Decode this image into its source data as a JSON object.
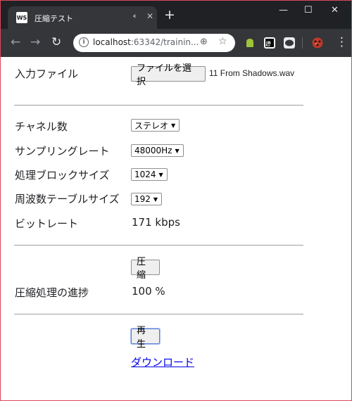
{
  "browser": {
    "tab": {
      "favicon_text": "WS",
      "title": "圧縮テスト",
      "audio_icon": "speaker-icon",
      "close_label": "✕"
    },
    "new_tab_label": "+",
    "window_controls": {
      "minimize": "—",
      "maximize": "☐",
      "close": "✕"
    },
    "nav": {
      "back": "←",
      "forward": "→",
      "reload": "↻"
    },
    "address": {
      "host": "localhost",
      "rest": ":63342/trainin..."
    },
    "zoom_icon": "⊕",
    "star_icon": "☆",
    "menu_icon": "⋮",
    "extensions": [
      "android-icon",
      "jb-icon",
      "line-icon",
      "ladybug-icon"
    ]
  },
  "form": {
    "input_file": {
      "label": "入力ファイル",
      "button": "ファイルを選択",
      "file_name": "11 From Shadows.wav"
    },
    "channels": {
      "label": "チャネル数",
      "selected": "ステレオ"
    },
    "sample_rate": {
      "label": "サンプリングレート",
      "selected": "48000Hz"
    },
    "block_size": {
      "label": "処理ブロックサイズ",
      "selected": "1024"
    },
    "freq_table_size": {
      "label": "周波数テーブルサイズ",
      "selected": "192"
    },
    "bitrate": {
      "label": "ビットレート",
      "value": "171 kbps"
    },
    "compress_button": "圧縮",
    "progress": {
      "label": "圧縮処理の進捗",
      "value": "100 %"
    },
    "play_button": "再生",
    "download_link": "ダウンロード"
  },
  "colors": {
    "titlebar": "#202124",
    "toolbar": "#35363a",
    "link": "#0000ee",
    "window_border": "#d9485f"
  }
}
